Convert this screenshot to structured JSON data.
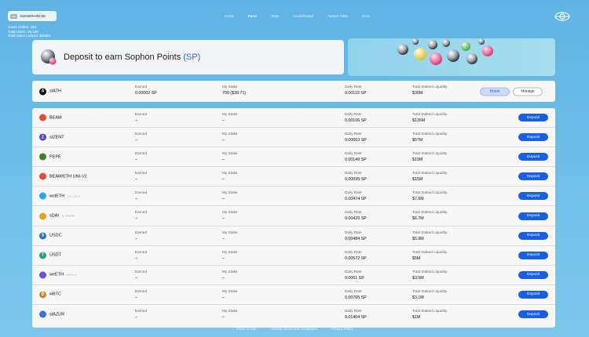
{
  "header": {
    "wallet_tag": "sso",
    "wallet_address": "0xE969••••9C58",
    "stats": [
      "Users Online: 153",
      "Total Users: 26,129",
      "Total Value Locked: $369M"
    ],
    "nav": [
      {
        "label": "Home",
        "active": false
      },
      {
        "label": "Farm",
        "active": true
      },
      {
        "label": "Stats",
        "active": false
      },
      {
        "label": "Leaderboard",
        "active": false
      },
      {
        "label": "Farmer Stats",
        "active": false
      },
      {
        "label": "Docs",
        "active": false
      }
    ]
  },
  "hero": {
    "title_prefix": "Deposit to earn Sophon Points ",
    "title_highlight": "(SP)"
  },
  "labels": {
    "earned": "Earned",
    "my_stake": "My Stake",
    "daily_rate": "Daily Rate",
    "total_staked": "Total Staked Liquidity",
    "deposit": "Deposit",
    "boost": "Boost",
    "manage": "Manage"
  },
  "staked_pool": {
    "name": "stATH",
    "icon": "A",
    "color": "#111111",
    "earned": "0.00002 SP",
    "stake": "700 ($38.71)",
    "rate": "0.00119 SP",
    "liquidity": "$30M"
  },
  "pools": [
    {
      "name": "BEAM",
      "icon": "",
      "color": "#e34a3c",
      "partner": "",
      "earned": "–",
      "stake": "–",
      "rate": "0.00106 SP",
      "liquidity": "$136M"
    },
    {
      "name": "stZENT",
      "icon": "Z",
      "color": "#5b3fd1",
      "partner": "",
      "earned": "–",
      "stake": "–",
      "rate": "0.00063 SP",
      "liquidity": "$57M"
    },
    {
      "name": "PEPE",
      "icon": "",
      "color": "#3f7d2c",
      "partner": "",
      "earned": "–",
      "stake": "–",
      "rate": "0.00149 SP",
      "liquidity": "$19M"
    },
    {
      "name": "BEAM/ETH UNI-V2",
      "icon": "",
      "color": "#e34a3c",
      "partner": "",
      "earned": "–",
      "stake": "–",
      "rate": "0.00095 SP",
      "liquidity": "$15M"
    },
    {
      "name": "wstETH",
      "icon": "",
      "color": "#2aa7e4",
      "partner": "♦ L I D O",
      "earned": "–",
      "stake": "–",
      "rate": "0.00474 SP",
      "liquidity": "$7.6M"
    },
    {
      "name": "sDAI",
      "icon": "",
      "color": "#e3a51f",
      "partner": "◎ SPARK",
      "earned": "–",
      "stake": "–",
      "rate": "0.00429 SP",
      "liquidity": "$6.7M"
    },
    {
      "name": "USDC",
      "icon": "$",
      "color": "#2775ca",
      "partner": "",
      "earned": "–",
      "stake": "–",
      "rate": "0.00484 SP",
      "liquidity": "$5.9M"
    },
    {
      "name": "USDT",
      "icon": "T",
      "color": "#26a17b",
      "partner": "",
      "earned": "–",
      "stake": "–",
      "rate": "0.00572 SP",
      "liquidity": "$5M"
    },
    {
      "name": "weETH",
      "icon": "",
      "color": "#6c4fd6",
      "partner": "ether.fi",
      "earned": "–",
      "stake": "–",
      "rate": "0.0061 SP",
      "liquidity": "$3.5M"
    },
    {
      "name": "wBTC",
      "icon": "₿",
      "color": "#b9893a",
      "partner": "",
      "earned": "–",
      "stake": "–",
      "rate": "0.00705 SP",
      "liquidity": "$3.1M"
    },
    {
      "name": "stAZUR",
      "icon": "",
      "color": "#3a6fe2",
      "partner": "",
      "earned": "–",
      "stake": "–",
      "rate": "0.01404 SP",
      "liquidity": "$1M"
    }
  ],
  "footer": [
    "Terms of Use",
    "Airdrop Terms and Conditions",
    "Privacy Policy"
  ]
}
